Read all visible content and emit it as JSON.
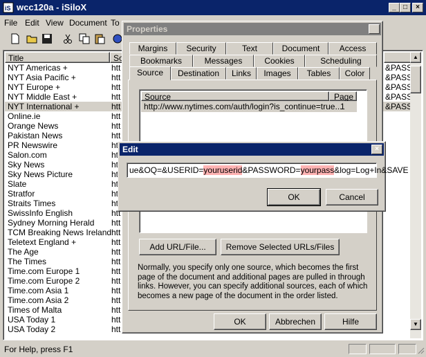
{
  "main_window": {
    "title": "wcc120a - iSiloX",
    "menu": [
      "File",
      "Edit",
      "View",
      "Document",
      "To"
    ],
    "columns": {
      "title": "Title",
      "source": "Sou"
    },
    "rows": [
      "NYT Americas +",
      "NYT Asia Pacific +",
      "NYT Europe +",
      "NYT Middle East +",
      "NYT International +",
      "Online.ie",
      "Orange News",
      "Pakistan News",
      "PR Newswire",
      "Salon.com",
      "Sky News",
      "Sky News Picture",
      "Slate",
      "Stratfor",
      "Straits Times",
      "SwissInfo English",
      "Sydney Morning Herald",
      "TCM Breaking News Ireland",
      "Teletext England +",
      "The Age",
      "The Times",
      "Time.com Europe 1",
      "Time.com Europe 2",
      "Time.com Asia 1",
      "Time.com Asia 2",
      "Times of Malta",
      "USA Today 1",
      "USA Today 2"
    ],
    "row_source_prefix": "htt",
    "right_column_text": "&PASSW",
    "status": "For Help, press F1"
  },
  "properties_dialog": {
    "title": "Properties",
    "tabs_row1": [
      "Margins",
      "Security",
      "Text",
      "Document",
      "Access"
    ],
    "tabs_row2": [
      "Bookmarks",
      "Messages",
      "Cookies",
      "Scheduling"
    ],
    "tabs_row3": [
      "Source",
      "Destination",
      "Links",
      "Images",
      "Tables",
      "Color"
    ],
    "source_header": "Source",
    "page_header": "Page",
    "source_url": "http://www.nytimes.com/auth/login?is_continue=true...",
    "source_page": "1",
    "add_url_label": "Add URL/File...",
    "remove_urls_label": "Remove Selected URLs/Files",
    "info_text": "Normally, you specify only one source, which becomes the first page of the document and additional pages are pulled in through links. However, you can specify additional sources, each of which becomes a new page of the document in the order listed.",
    "ok_label": "OK",
    "cancel_label": "Abbrechen",
    "help_label": "Hilfe"
  },
  "edit_dialog": {
    "title": "Edit",
    "value_part1": "ue&OQ=&USERID=",
    "value_userid": "youruserid",
    "value_part2": "&PASSWORD=",
    "value_pass": "yourpass",
    "value_part3": "&log=Log+In&SAVE",
    "ok_label": "OK",
    "cancel_label": "Cancel"
  },
  "colors": {
    "active_title": "#0a246a",
    "inactive_title": "#808080",
    "selection": "#d4d0c8",
    "highlight_mark": "#ffb3b3"
  }
}
